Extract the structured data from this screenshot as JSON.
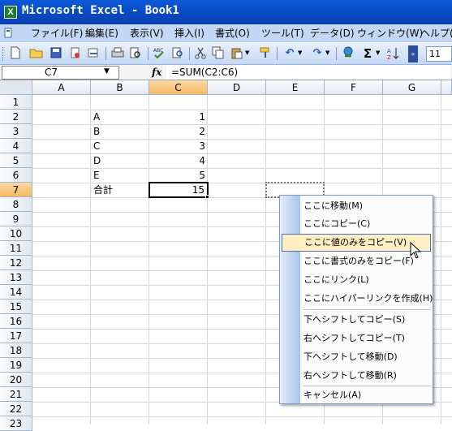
{
  "app": {
    "title": "Microsoft Excel - Book1",
    "icon_letter": "X"
  },
  "menu": {
    "items": [
      "ファイル(F)",
      "編集(E)",
      "表示(V)",
      "挿入(I)",
      "書式(O)",
      "ツール(T)",
      "データ(D)",
      "ウィンドウ(W)",
      "ヘルプ(H)"
    ]
  },
  "toolbar": {
    "icons": [
      "new-icon",
      "open-icon",
      "save-icon",
      "permission-icon",
      "mail-icon",
      "print-icon",
      "print-preview-icon",
      "spelling-icon",
      "research-icon",
      "cut-icon",
      "copy-icon",
      "paste-icon",
      "format-painter-icon",
      "undo-icon",
      "redo-icon",
      "hyperlink-icon",
      "autosum-icon",
      "sort-ascending-icon",
      "toolbar-options-icon"
    ],
    "font_size": "11"
  },
  "formula_bar": {
    "name_box": "C7",
    "fx": "fx",
    "formula": "=SUM(C2:C6)"
  },
  "sheet": {
    "columns": [
      "A",
      "B",
      "C",
      "D",
      "E",
      "F",
      "G"
    ],
    "selected_column": "C",
    "rows": [
      "1",
      "2",
      "3",
      "4",
      "5",
      "6",
      "7",
      "8",
      "9",
      "10",
      "11",
      "12",
      "13",
      "14",
      "15",
      "16",
      "17",
      "18",
      "19",
      "20",
      "21",
      "22",
      "23"
    ],
    "selected_row": "7",
    "data": [
      {
        "label": "A",
        "value": "1"
      },
      {
        "label": "B",
        "value": "2"
      },
      {
        "label": "C",
        "value": "3"
      },
      {
        "label": "D",
        "value": "4"
      },
      {
        "label": "E",
        "value": "5"
      },
      {
        "label": "合計",
        "value": "15"
      }
    ]
  },
  "context_menu": {
    "items": [
      "ここに移動(M)",
      "ここにコピー(C)",
      "ここに値のみをコピー(V)",
      "ここに書式のみをコピー(F)",
      "ここにリンク(L)",
      "ここにハイパーリンクを作成(H)",
      "下へシフトしてコピー(S)",
      "右へシフトしてコピー(T)",
      "下へシフトして移動(D)",
      "右へシフトして移動(R)",
      "キャンセル(A)"
    ],
    "highlighted_index": 2
  },
  "colors": {
    "titlebar": "#0a4fc8",
    "selection_header": "#f6b862",
    "menu_highlight": "#ffeec2"
  }
}
